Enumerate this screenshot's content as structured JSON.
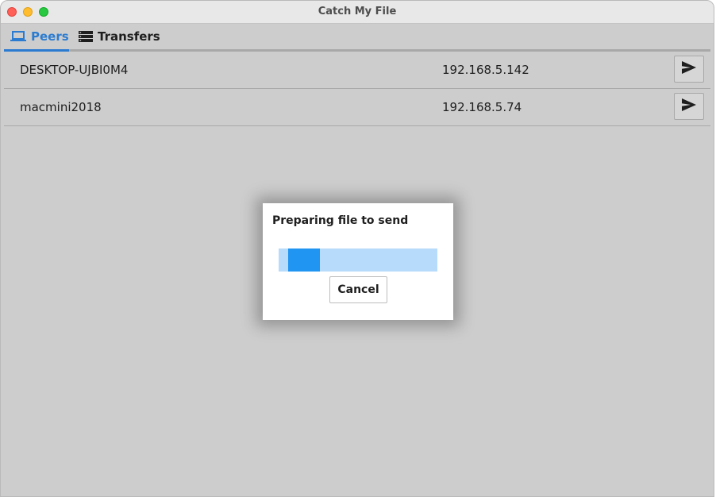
{
  "window": {
    "title": "Catch My File"
  },
  "tabs": [
    {
      "label": "Peers",
      "icon": "laptop-icon",
      "active": true
    },
    {
      "label": "Transfers",
      "icon": "list-icon",
      "active": false
    }
  ],
  "peers": [
    {
      "name": "DESKTOP-UJBI0M4",
      "ip": "192.168.5.142",
      "action_icon": "send-icon"
    },
    {
      "name": "macmini2018",
      "ip": "192.168.5.74",
      "action_icon": "send-icon"
    }
  ],
  "dialog": {
    "title": "Preparing file to send",
    "progress": {
      "indeterminate": true,
      "chunk_start": 0.06,
      "chunk_end": 0.26
    },
    "cancel_label": "Cancel"
  },
  "colors": {
    "accent": "#2b7bd0",
    "progress_track": "#b6dbfb",
    "progress_fill": "#2195f2",
    "background": "#cdcdcd"
  }
}
